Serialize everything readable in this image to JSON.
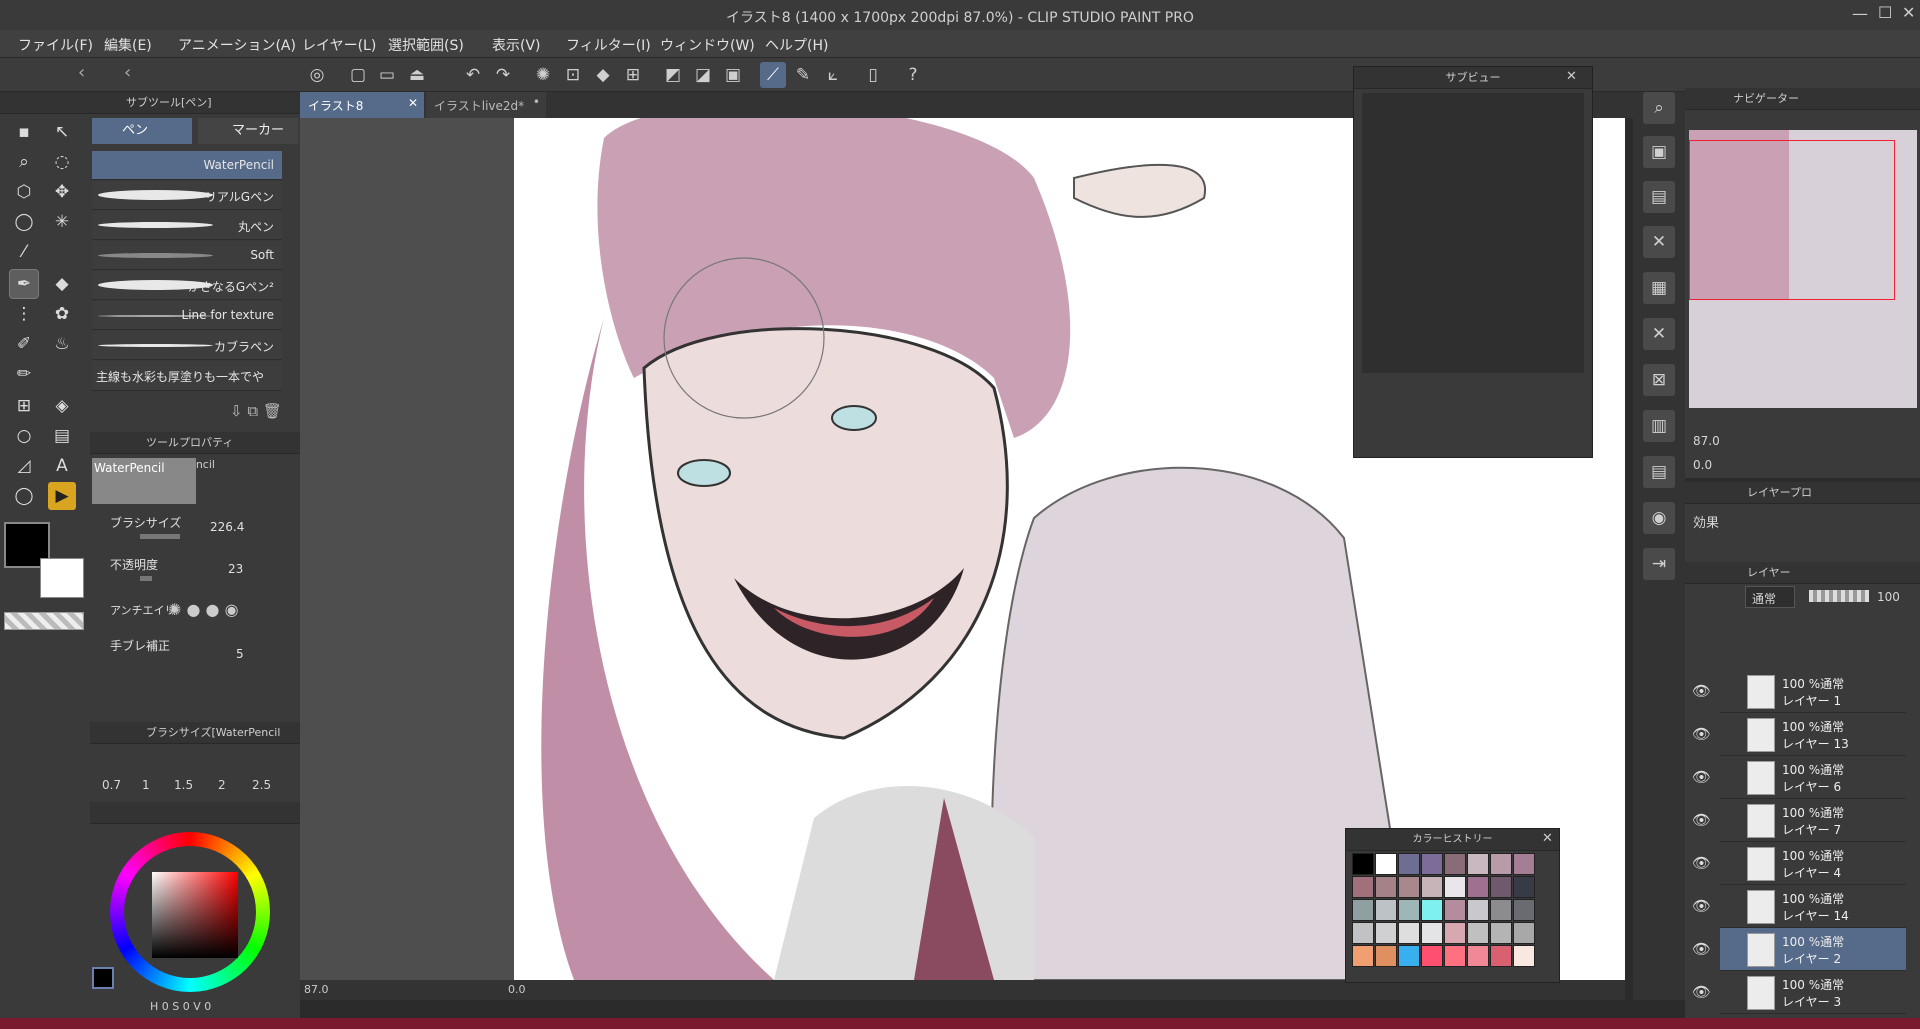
{
  "window": {
    "title": "イラスト8 (1400 x 1700px 200dpi 87.0%)  - CLIP STUDIO PAINT PRO"
  },
  "menu": [
    "ファイル(F)",
    "編集(E)",
    "アニメーション(A)",
    "レイヤー(L)",
    "選択範囲(S)",
    "表示(V)",
    "フィルター(I)",
    "ウィンドウ(W)",
    "ヘルプ(H)"
  ],
  "subtool": {
    "title": "サブツール[ペン]",
    "tab_pen": "ペン",
    "tab_marker": "マーカー",
    "brushes": [
      "WaterPencil",
      "リアルGペン",
      "丸ペン",
      "Soft",
      "かさなるGペン²",
      "Line for texture",
      "カブラペン",
      "主線も水彩も厚塗りも一本でや"
    ]
  },
  "tool_property": {
    "title": "ツールプロパティ[WaterPencil",
    "preview_label": "WaterPencil",
    "brush_size_label": "ブラシサイズ",
    "brush_size_value": "226.4",
    "opacity_label": "不透明度",
    "opacity_value": "23",
    "antialias_label": "アンチエイリ",
    "stabilizer_label": "手ブレ補正",
    "stabilizer_value": "5"
  },
  "brush_size_palette": {
    "title": "ブラシサイズ[WaterPencil",
    "sizes": [
      "0.7",
      "1",
      "1.5",
      "2",
      "2.5"
    ]
  },
  "color": {
    "main": "#000000",
    "sub": "#ffffff",
    "hsv": {
      "h_label": "H",
      "h": "0",
      "s_label": "S",
      "s": "0",
      "v_label": "V",
      "v": "0"
    }
  },
  "doc_tabs": [
    "イラスト8",
    "イラストlive2d*"
  ],
  "canvas": {
    "zoom": "87.0",
    "angle": "0.0"
  },
  "subview": {
    "title": "サブビュー"
  },
  "color_history": {
    "title": "カラーヒストリー",
    "swatches": [
      "#000000",
      "#ffffff",
      "#6e6d94",
      "#7c6c9a",
      "#8a6b78",
      "#c9b8c0",
      "#b89aa8",
      "#a47e95",
      "#a1707c",
      "#a58288",
      "#a8878d",
      "#c7b4b9",
      "#e8e6ea",
      "#a07090",
      "#6e5a6c",
      "#383a48",
      "#8fa0a2",
      "#bcc2c6",
      "#9fb6b8",
      "#7ff0f0",
      "#b48c9e",
      "#c9c8cc",
      "#8c8c90",
      "#6a6a72",
      "#c2c2c4",
      "#d0d0d2",
      "#dedede",
      "#e4e4e6",
      "#d8a8b0",
      "#c0c0c0",
      "#b4b4b4",
      "#a8a8a8",
      "#f0a070",
      "#e09060",
      "#38b0f0",
      "#ff5070",
      "#ff7080",
      "#f08898",
      "#d86070",
      "#f8e8e0"
    ]
  },
  "navigator": {
    "title": "ナビゲーター",
    "zoom": "87.0",
    "rotate": "0.0"
  },
  "layer_property": {
    "title": "レイヤープロ",
    "effect_label": "効果"
  },
  "layers_panel": {
    "title": "レイヤー",
    "blend": "通常",
    "opacity": "100",
    "layers": [
      {
        "mode": "100 %通常",
        "name": "レイヤー 1"
      },
      {
        "mode": "100 %通常",
        "name": "レイヤー 13"
      },
      {
        "mode": "100 %通常",
        "name": "レイヤー 6"
      },
      {
        "mode": "100 %通常",
        "name": "レイヤー 7"
      },
      {
        "mode": "100 %通常",
        "name": "レイヤー 4"
      },
      {
        "mode": "100 %通常",
        "name": "レイヤー 14"
      },
      {
        "mode": "100 %通常",
        "name": "レイヤー 2"
      },
      {
        "mode": "100 %通常",
        "name": "レイヤー 3"
      }
    ]
  }
}
